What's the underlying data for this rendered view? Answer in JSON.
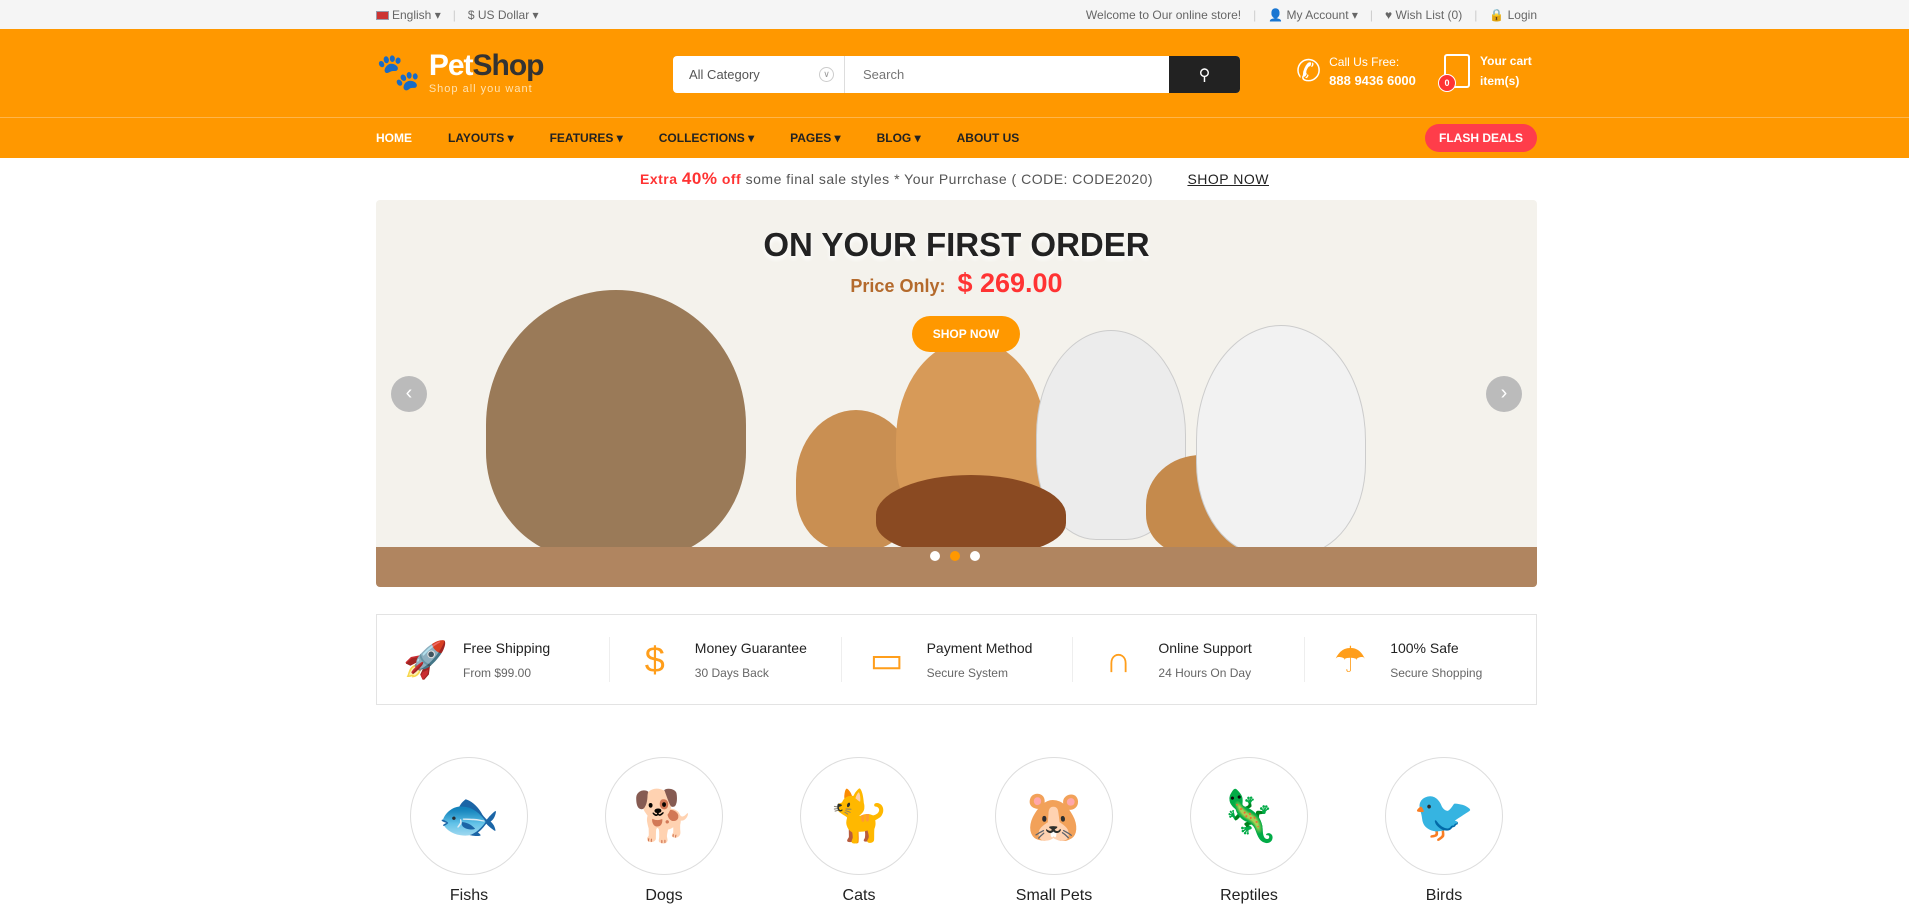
{
  "topbar": {
    "language": "English",
    "currency": "$ US Dollar",
    "welcome": "Welcome to Our online store!",
    "account": "My Account",
    "wishlist": "Wish List (0)",
    "login": "Login"
  },
  "header": {
    "logo_name_a": "Pet",
    "logo_name_b": "Shop",
    "logo_tagline": "Shop all you want",
    "category": "All Category",
    "search_placeholder": "Search",
    "call_label": "Call Us Free:",
    "phone": "888 9436 6000",
    "cart_label": "Your cart",
    "cart_items": "item(s)",
    "cart_count": "0"
  },
  "nav": {
    "items": [
      "HOME",
      "LAYOUTS",
      "FEATURES",
      "COLLECTIONS",
      "PAGES",
      "BLOG",
      "ABOUT US"
    ],
    "flash": "FLASH DEALS"
  },
  "promo": {
    "extra": "Extra",
    "pct": "40%",
    "off": "off",
    "text": "some final sale styles * Your Purrchase ( CODE: CODE2020)",
    "shop": "SHOP NOW"
  },
  "banner": {
    "title": "ON YOUR FIRST ORDER",
    "price_label": "Price Only:",
    "price": "$ 269.00",
    "button": "SHOP NOW",
    "active_slide": 2,
    "slides": 3
  },
  "features": [
    {
      "icon": "rocket-icon",
      "title": "Free Shipping",
      "sub": "From $99.00"
    },
    {
      "icon": "money-bag-icon",
      "title": "Money Guarantee",
      "sub": "30 Days Back"
    },
    {
      "icon": "wallet-icon",
      "title": "Payment Method",
      "sub": "Secure System"
    },
    {
      "icon": "headphones-icon",
      "title": "Online Support",
      "sub": "24 Hours On Day"
    },
    {
      "icon": "umbrella-icon",
      "title": "100% Safe",
      "sub": "Secure Shopping"
    }
  ],
  "categories": [
    "Fishs",
    "Dogs",
    "Cats",
    "Small Pets",
    "Reptiles",
    "Birds"
  ],
  "colors": {
    "brand": "#ff9800",
    "accent": "#ff3d4a",
    "dark": "#222222"
  }
}
